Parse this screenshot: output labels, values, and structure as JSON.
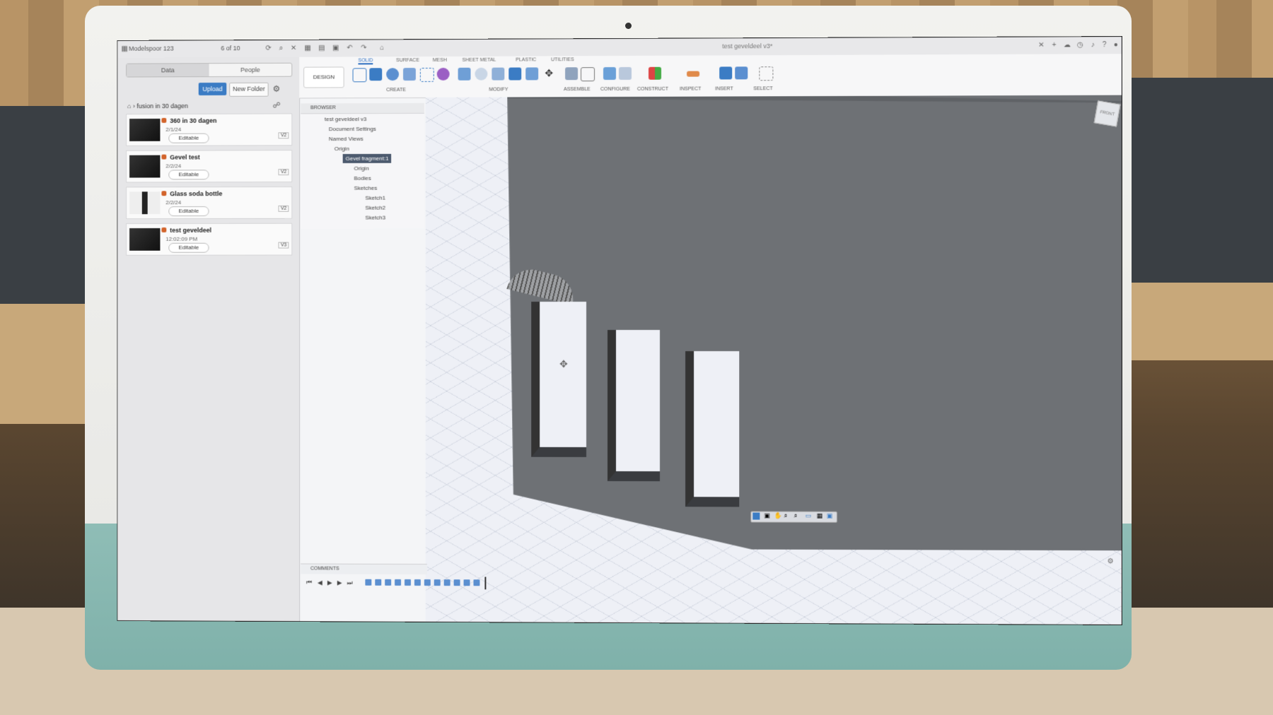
{
  "app": {
    "workspace": "Modelspoor 123",
    "doc_count": "6 of 10",
    "doc_title": "test geveldeel v3*"
  },
  "data_panel": {
    "tabs": [
      "Data",
      "People"
    ],
    "upload_label": "Upload",
    "new_folder_label": "New Folder",
    "breadcrumb": "fusion in 30 dagen",
    "items": [
      {
        "name": "360 in 30 dagen",
        "date": "2/1/24",
        "status": "Editable",
        "version": "V2"
      },
      {
        "name": "Gevel test",
        "date": "2/2/24",
        "status": "Editable",
        "version": "V2"
      },
      {
        "name": "Glass soda bottle",
        "date": "2/2/24",
        "status": "Editable",
        "version": "V2"
      },
      {
        "name": "test geveldeel",
        "date": "12:02:09 PM",
        "status": "Editable",
        "version": "V3"
      }
    ]
  },
  "toolbar": {
    "workspace_button": "DESIGN",
    "tabs": [
      "SOLID",
      "SURFACE",
      "MESH",
      "SHEET METAL",
      "PLASTIC",
      "UTILITIES"
    ],
    "groups": [
      "CREATE",
      "MODIFY",
      "ASSEMBLE",
      "CONFIGURE",
      "CONSTRUCT",
      "INSPECT",
      "INSERT",
      "SELECT"
    ]
  },
  "browser": {
    "title": "BROWSER",
    "root": "test geveldeel v3",
    "nodes": [
      "Document Settings",
      "Named Views",
      "Origin",
      "Gevel fragment:1",
      "Origin",
      "Bodies",
      "Sketches",
      "Sketch1",
      "Sketch2",
      "Sketch3"
    ]
  },
  "bottom": {
    "comments_label": "COMMENTS"
  },
  "colors": {
    "accent": "#3b7cc4",
    "selection": "#4c5a6e",
    "model_gray": "#6e7175"
  }
}
